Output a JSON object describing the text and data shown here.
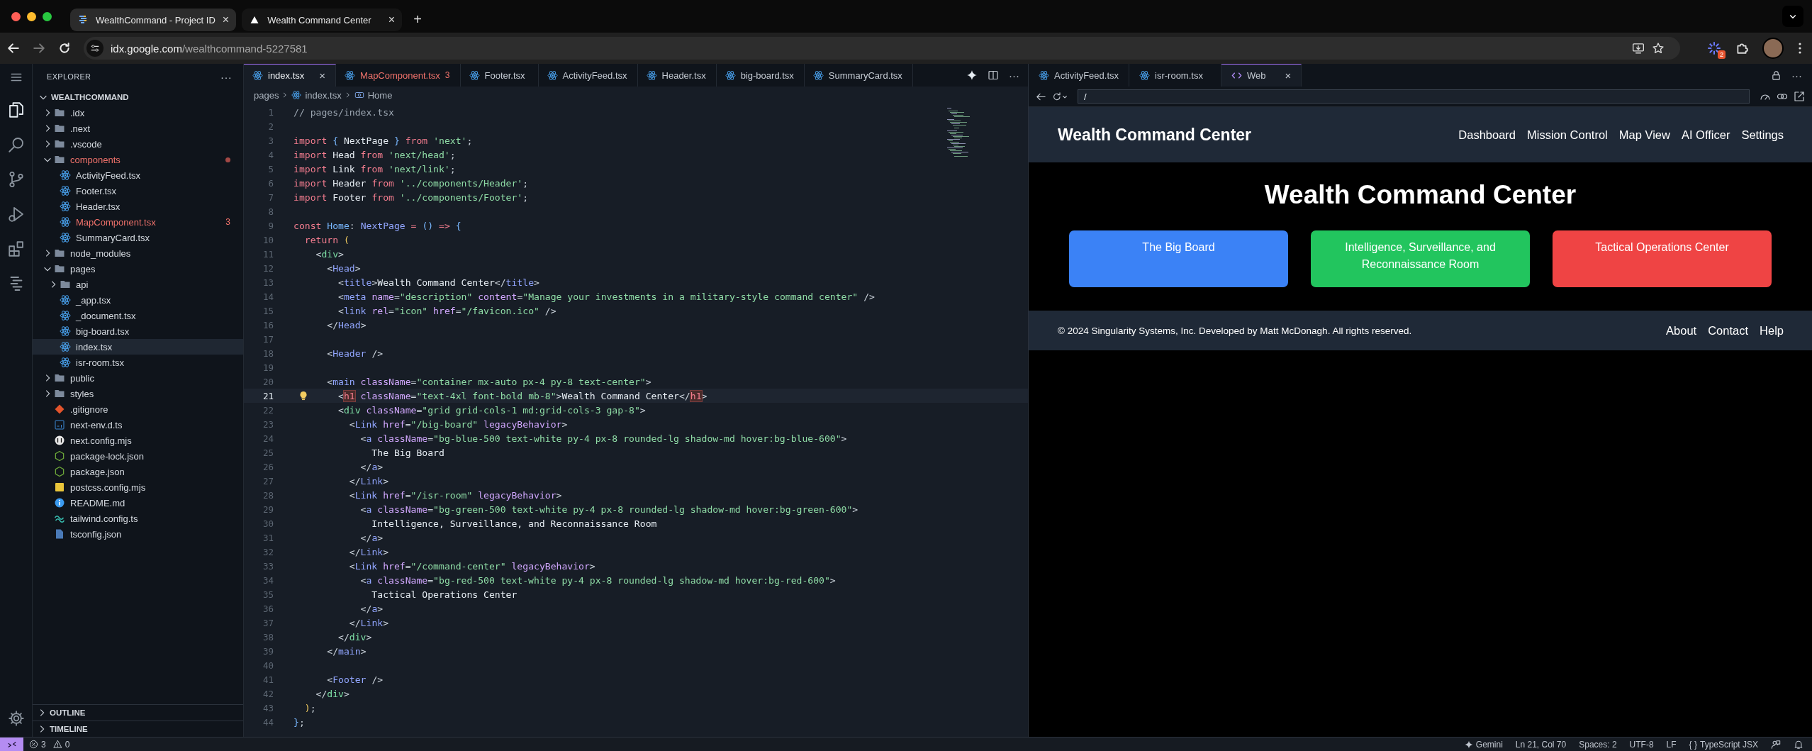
{
  "browser": {
    "tabs": [
      {
        "title": "WealthCommand - Project ID",
        "kind": "idx",
        "selected": true,
        "close": "×"
      },
      {
        "title": "Wealth Command Center",
        "kind": "site",
        "selected": false,
        "close": "×"
      }
    ],
    "new_tab": "+",
    "address": {
      "host": "idx.google.com",
      "path": "/wealthcommand-5227581"
    },
    "extension_badge": "2"
  },
  "activity_bar": [
    {
      "kind": "files",
      "selected": true
    },
    {
      "kind": "search",
      "selected": false
    },
    {
      "kind": "branch",
      "selected": false
    },
    {
      "kind": "run",
      "selected": false
    },
    {
      "kind": "extensions",
      "selected": false
    },
    {
      "kind": "list",
      "selected": false
    }
  ],
  "explorer": {
    "title": "EXPLORER",
    "more": "···",
    "root": "WEALTHCOMMAND",
    "items": [
      {
        "label": ".idx",
        "kind": "folder",
        "expanded": false,
        "selected": false,
        "error": false
      },
      {
        "label": ".next",
        "kind": "folder",
        "expanded": false,
        "selected": false,
        "error": false
      },
      {
        "label": ".vscode",
        "kind": "folder",
        "expanded": false,
        "selected": false,
        "error": false
      },
      {
        "label": "components",
        "kind": "folder",
        "expanded": true,
        "selected": false,
        "error": true,
        "children": [
          {
            "label": "ActivityFeed.tsx",
            "kind": "react",
            "selected": false,
            "error": false
          },
          {
            "label": "Footer.tsx",
            "kind": "react",
            "selected": false,
            "error": false
          },
          {
            "label": "Header.tsx",
            "kind": "react",
            "selected": false,
            "error": false
          },
          {
            "label": "MapComponent.tsx",
            "kind": "react",
            "selected": false,
            "error": true,
            "badge": "3"
          },
          {
            "label": "SummaryCard.tsx",
            "kind": "react",
            "selected": false,
            "error": false
          }
        ]
      },
      {
        "label": "node_modules",
        "kind": "folder",
        "expanded": false,
        "selected": false,
        "error": false
      },
      {
        "label": "pages",
        "kind": "folder",
        "expanded": true,
        "selected": false,
        "error": false,
        "children": [
          {
            "label": "api",
            "kind": "folder",
            "expanded": false,
            "selected": false,
            "error": false
          },
          {
            "label": "_app.tsx",
            "kind": "react",
            "selected": false,
            "error": false
          },
          {
            "label": "_document.tsx",
            "kind": "react",
            "selected": false,
            "error": false
          },
          {
            "label": "big-board.tsx",
            "kind": "react",
            "selected": false,
            "error": false
          },
          {
            "label": "index.tsx",
            "kind": "react",
            "selected": true,
            "error": false
          },
          {
            "label": "isr-room.tsx",
            "kind": "react",
            "selected": false,
            "error": false
          }
        ]
      },
      {
        "label": "public",
        "kind": "folder",
        "expanded": false,
        "selected": false,
        "error": false
      },
      {
        "label": "styles",
        "kind": "folder",
        "expanded": false,
        "selected": false,
        "error": false
      },
      {
        "label": ".gitignore",
        "kind": "git",
        "selected": false,
        "error": false
      },
      {
        "label": "next-env.d.ts",
        "kind": "ts",
        "selected": false,
        "error": false
      },
      {
        "label": "next.config.mjs",
        "kind": "next",
        "selected": false,
        "error": false
      },
      {
        "label": "package-lock.json",
        "kind": "json",
        "selected": false,
        "error": false
      },
      {
        "label": "package.json",
        "kind": "json",
        "selected": false,
        "error": false
      },
      {
        "label": "postcss.config.mjs",
        "kind": "js",
        "selected": false,
        "error": false
      },
      {
        "label": "README.md",
        "kind": "info",
        "selected": false,
        "error": false
      },
      {
        "label": "tailwind.config.ts",
        "kind": "tailwind",
        "selected": false,
        "error": false
      },
      {
        "label": "tsconfig.json",
        "kind": "tsconfig",
        "selected": false,
        "error": false
      }
    ],
    "sections": [
      {
        "label": "OUTLINE",
        "expanded": false
      },
      {
        "label": "TIMELINE",
        "expanded": false
      }
    ]
  },
  "editor": {
    "tabs": [
      {
        "label": "index.tsx",
        "selected": true,
        "error": false,
        "close": "×"
      },
      {
        "label": "MapComponent.tsx",
        "selected": false,
        "error": true,
        "badge": "3"
      },
      {
        "label": "Footer.tsx",
        "selected": false,
        "error": false
      },
      {
        "label": "ActivityFeed.tsx",
        "selected": false,
        "error": false
      },
      {
        "label": "Header.tsx",
        "selected": false,
        "error": false
      },
      {
        "label": "big-board.tsx",
        "selected": false,
        "error": false
      },
      {
        "label": "SummaryCard.tsx",
        "selected": false,
        "error": false
      }
    ],
    "more": "···",
    "breadcrumb": [
      {
        "label": "pages",
        "kind": "folder"
      },
      {
        "label": "index.tsx",
        "kind": "react"
      },
      {
        "label": "Home",
        "kind": "symbol"
      }
    ],
    "lines": [
      {
        "n": "1",
        "current": false,
        "tokens": [
          {
            "kind": "com",
            "text": "// pages/index.tsx"
          }
        ]
      },
      {
        "n": "2",
        "current": false
      },
      {
        "n": "3",
        "current": false,
        "tokens": [
          {
            "kind": "kw",
            "text": "import "
          },
          {
            "kind": "fn",
            "text": "{ "
          },
          {
            "kind": "txt",
            "text": "NextPage "
          },
          {
            "kind": "fn",
            "text": "} "
          },
          {
            "kind": "kw",
            "text": "from "
          },
          {
            "kind": "str",
            "text": "'next'"
          },
          {
            "kind": "p",
            "text": ";"
          }
        ]
      },
      {
        "n": "4",
        "current": false,
        "tokens": [
          {
            "kind": "kw",
            "text": "import "
          },
          {
            "kind": "txt",
            "text": "Head "
          },
          {
            "kind": "kw",
            "text": "from "
          },
          {
            "kind": "str",
            "text": "'next/head'"
          },
          {
            "kind": "p",
            "text": ";"
          }
        ]
      },
      {
        "n": "5",
        "current": false,
        "tokens": [
          {
            "kind": "kw",
            "text": "import "
          },
          {
            "kind": "txt",
            "text": "Link "
          },
          {
            "kind": "kw",
            "text": "from "
          },
          {
            "kind": "str",
            "text": "'next/link'"
          },
          {
            "kind": "p",
            "text": ";"
          }
        ]
      },
      {
        "n": "6",
        "current": false,
        "tokens": [
          {
            "kind": "kw",
            "text": "import "
          },
          {
            "kind": "txt",
            "text": "Header "
          },
          {
            "kind": "kw",
            "text": "from "
          },
          {
            "kind": "str",
            "text": "'../components/Header'"
          },
          {
            "kind": "p",
            "text": ";"
          }
        ]
      },
      {
        "n": "7",
        "current": false,
        "tokens": [
          {
            "kind": "kw",
            "text": "import "
          },
          {
            "kind": "txt",
            "text": "Footer "
          },
          {
            "kind": "kw",
            "text": "from "
          },
          {
            "kind": "str",
            "text": "'../components/Footer'"
          },
          {
            "kind": "p",
            "text": ";"
          }
        ]
      },
      {
        "n": "8",
        "current": false
      },
      {
        "n": "9",
        "current": false,
        "tokens": [
          {
            "kind": "kw",
            "text": "const "
          },
          {
            "kind": "fn",
            "text": "Home"
          },
          {
            "kind": "p",
            "text": ": "
          },
          {
            "kind": "tag",
            "text": "NextPage "
          },
          {
            "kind": "kw",
            "text": "= "
          },
          {
            "kind": "fn",
            "text": "() "
          },
          {
            "kind": "kw",
            "text": "=> "
          },
          {
            "kind": "fn",
            "text": "{"
          }
        ]
      },
      {
        "n": "10",
        "current": false,
        "tokens": [
          {
            "kind": "kw",
            "text": "  return "
          },
          {
            "kind": "paren",
            "text": "("
          }
        ]
      },
      {
        "n": "11",
        "current": false,
        "tokens": [
          {
            "kind": "p",
            "text": "    <"
          },
          {
            "kind": "tagg",
            "text": "div"
          },
          {
            "kind": "p",
            "text": ">"
          }
        ]
      },
      {
        "n": "12",
        "current": false,
        "tokens": [
          {
            "kind": "p",
            "text": "      <"
          },
          {
            "kind": "tag",
            "text": "Head"
          },
          {
            "kind": "p",
            "text": ">"
          }
        ]
      },
      {
        "n": "13",
        "current": false,
        "tokens": [
          {
            "kind": "p",
            "text": "        <"
          },
          {
            "kind": "tag",
            "text": "title"
          },
          {
            "kind": "p",
            "text": ">"
          },
          {
            "kind": "txt",
            "text": "Wealth Command Center"
          },
          {
            "kind": "p",
            "text": "</"
          },
          {
            "kind": "tag",
            "text": "title"
          },
          {
            "kind": "p",
            "text": ">"
          }
        ]
      },
      {
        "n": "14",
        "current": false,
        "tokens": [
          {
            "kind": "p",
            "text": "        <"
          },
          {
            "kind": "tag",
            "text": "meta "
          },
          {
            "kind": "attr",
            "text": "name"
          },
          {
            "kind": "p",
            "text": "="
          },
          {
            "kind": "str",
            "text": "\"description\" "
          },
          {
            "kind": "attr",
            "text": "content"
          },
          {
            "kind": "p",
            "text": "="
          },
          {
            "kind": "str",
            "text": "\"Manage your investments in a military-style command center\" "
          },
          {
            "kind": "p",
            "text": "/>"
          }
        ]
      },
      {
        "n": "15",
        "current": false,
        "tokens": [
          {
            "kind": "p",
            "text": "        <"
          },
          {
            "kind": "tag",
            "text": "link "
          },
          {
            "kind": "attr",
            "text": "rel"
          },
          {
            "kind": "p",
            "text": "="
          },
          {
            "kind": "str",
            "text": "\"icon\" "
          },
          {
            "kind": "attr",
            "text": "href"
          },
          {
            "kind": "p",
            "text": "="
          },
          {
            "kind": "str",
            "text": "\"/favicon.ico\" "
          },
          {
            "kind": "p",
            "text": "/>"
          }
        ]
      },
      {
        "n": "16",
        "current": false,
        "tokens": [
          {
            "kind": "p",
            "text": "      </"
          },
          {
            "kind": "tag",
            "text": "Head"
          },
          {
            "kind": "p",
            "text": ">"
          }
        ]
      },
      {
        "n": "17",
        "current": false
      },
      {
        "n": "18",
        "current": false,
        "tokens": [
          {
            "kind": "p",
            "text": "      <"
          },
          {
            "kind": "tag",
            "text": "Header "
          },
          {
            "kind": "p",
            "text": "/>"
          }
        ]
      },
      {
        "n": "19",
        "current": false
      },
      {
        "n": "20",
        "current": false,
        "tokens": [
          {
            "kind": "p",
            "text": "      <"
          },
          {
            "kind": "tag",
            "text": "main "
          },
          {
            "kind": "attr",
            "text": "className"
          },
          {
            "kind": "p",
            "text": "="
          },
          {
            "kind": "str",
            "text": "\"container mx-auto px-4 py-8 text-center\""
          },
          {
            "kind": "p",
            "text": ">"
          }
        ]
      },
      {
        "n": "21",
        "current": true,
        "tokens": [
          {
            "kind": "p",
            "text": "        <"
          },
          {
            "kind": "match",
            "text": "h1"
          },
          {
            "kind": "attr",
            "text": " className"
          },
          {
            "kind": "p",
            "text": "="
          },
          {
            "kind": "str",
            "text": "\"text-4xl font-bold mb-8\""
          },
          {
            "kind": "p",
            "text": ">"
          },
          {
            "kind": "txt",
            "text": "Wealth Command Center"
          },
          {
            "kind": "p",
            "text": "</"
          },
          {
            "kind": "match",
            "text": "h1"
          },
          {
            "kind": "p",
            "text": ">"
          }
        ]
      },
      {
        "n": "22",
        "current": false,
        "tokens": [
          {
            "kind": "p",
            "text": "        <"
          },
          {
            "kind": "tagg",
            "text": "div "
          },
          {
            "kind": "attr",
            "text": "className"
          },
          {
            "kind": "p",
            "text": "="
          },
          {
            "kind": "str",
            "text": "\"grid grid-cols-1 md:grid-cols-3 gap-8\""
          },
          {
            "kind": "p",
            "text": ">"
          }
        ]
      },
      {
        "n": "23",
        "current": false,
        "tokens": [
          {
            "kind": "p",
            "text": "          <"
          },
          {
            "kind": "tag",
            "text": "Link "
          },
          {
            "kind": "attr",
            "text": "href"
          },
          {
            "kind": "p",
            "text": "="
          },
          {
            "kind": "str",
            "text": "\"/big-board\" "
          },
          {
            "kind": "attr",
            "text": "legacyBehavior"
          },
          {
            "kind": "p",
            "text": ">"
          }
        ]
      },
      {
        "n": "24",
        "current": false,
        "tokens": [
          {
            "kind": "p",
            "text": "            <"
          },
          {
            "kind": "tag",
            "text": "a "
          },
          {
            "kind": "attr",
            "text": "className"
          },
          {
            "kind": "p",
            "text": "="
          },
          {
            "kind": "str",
            "text": "\"bg-blue-500 text-white py-4 px-8 rounded-lg shadow-md hover:bg-blue-600\""
          },
          {
            "kind": "p",
            "text": ">"
          }
        ]
      },
      {
        "n": "25",
        "current": false,
        "tokens": [
          {
            "kind": "txt",
            "text": "              The Big Board"
          }
        ]
      },
      {
        "n": "26",
        "current": false,
        "tokens": [
          {
            "kind": "p",
            "text": "            </"
          },
          {
            "kind": "tag",
            "text": "a"
          },
          {
            "kind": "p",
            "text": ">"
          }
        ]
      },
      {
        "n": "27",
        "current": false,
        "tokens": [
          {
            "kind": "p",
            "text": "          </"
          },
          {
            "kind": "tag",
            "text": "Link"
          },
          {
            "kind": "p",
            "text": ">"
          }
        ]
      },
      {
        "n": "28",
        "current": false,
        "tokens": [
          {
            "kind": "p",
            "text": "          <"
          },
          {
            "kind": "tag",
            "text": "Link "
          },
          {
            "kind": "attr",
            "text": "href"
          },
          {
            "kind": "p",
            "text": "="
          },
          {
            "kind": "str",
            "text": "\"/isr-room\" "
          },
          {
            "kind": "attr",
            "text": "legacyBehavior"
          },
          {
            "kind": "p",
            "text": ">"
          }
        ]
      },
      {
        "n": "29",
        "current": false,
        "tokens": [
          {
            "kind": "p",
            "text": "            <"
          },
          {
            "kind": "tag",
            "text": "a "
          },
          {
            "kind": "attr",
            "text": "className"
          },
          {
            "kind": "p",
            "text": "="
          },
          {
            "kind": "str",
            "text": "\"bg-green-500 text-white py-4 px-8 rounded-lg shadow-md hover:bg-green-600\""
          },
          {
            "kind": "p",
            "text": ">"
          }
        ]
      },
      {
        "n": "30",
        "current": false,
        "tokens": [
          {
            "kind": "txt",
            "text": "              Intelligence, Surveillance, and Reconnaissance Room"
          }
        ]
      },
      {
        "n": "31",
        "current": false,
        "tokens": [
          {
            "kind": "p",
            "text": "            </"
          },
          {
            "kind": "tag",
            "text": "a"
          },
          {
            "kind": "p",
            "text": ">"
          }
        ]
      },
      {
        "n": "32",
        "current": false,
        "tokens": [
          {
            "kind": "p",
            "text": "          </"
          },
          {
            "kind": "tag",
            "text": "Link"
          },
          {
            "kind": "p",
            "text": ">"
          }
        ]
      },
      {
        "n": "33",
        "current": false,
        "tokens": [
          {
            "kind": "p",
            "text": "          <"
          },
          {
            "kind": "tag",
            "text": "Link "
          },
          {
            "kind": "attr",
            "text": "href"
          },
          {
            "kind": "p",
            "text": "="
          },
          {
            "kind": "str",
            "text": "\"/command-center\" "
          },
          {
            "kind": "attr",
            "text": "legacyBehavior"
          },
          {
            "kind": "p",
            "text": ">"
          }
        ]
      },
      {
        "n": "34",
        "current": false,
        "tokens": [
          {
            "kind": "p",
            "text": "            <"
          },
          {
            "kind": "tag",
            "text": "a "
          },
          {
            "kind": "attr",
            "text": "className"
          },
          {
            "kind": "p",
            "text": "="
          },
          {
            "kind": "str",
            "text": "\"bg-red-500 text-white py-4 px-8 rounded-lg shadow-md hover:bg-red-600\""
          },
          {
            "kind": "p",
            "text": ">"
          }
        ]
      },
      {
        "n": "35",
        "current": false,
        "tokens": [
          {
            "kind": "txt",
            "text": "              Tactical Operations Center"
          }
        ]
      },
      {
        "n": "36",
        "current": false,
        "tokens": [
          {
            "kind": "p",
            "text": "            </"
          },
          {
            "kind": "tag",
            "text": "a"
          },
          {
            "kind": "p",
            "text": ">"
          }
        ]
      },
      {
        "n": "37",
        "current": false,
        "tokens": [
          {
            "kind": "p",
            "text": "          </"
          },
          {
            "kind": "tag",
            "text": "Link"
          },
          {
            "kind": "p",
            "text": ">"
          }
        ]
      },
      {
        "n": "38",
        "current": false,
        "tokens": [
          {
            "kind": "p",
            "text": "        </"
          },
          {
            "kind": "tagg",
            "text": "div"
          },
          {
            "kind": "p",
            "text": ">"
          }
        ]
      },
      {
        "n": "39",
        "current": false,
        "tokens": [
          {
            "kind": "p",
            "text": "      </"
          },
          {
            "kind": "tag",
            "text": "main"
          },
          {
            "kind": "p",
            "text": ">"
          }
        ]
      },
      {
        "n": "40",
        "current": false
      },
      {
        "n": "41",
        "current": false,
        "tokens": [
          {
            "kind": "p",
            "text": "      <"
          },
          {
            "kind": "tag",
            "text": "Footer "
          },
          {
            "kind": "p",
            "text": "/>"
          }
        ]
      },
      {
        "n": "42",
        "current": false,
        "tokens": [
          {
            "kind": "p",
            "text": "    </"
          },
          {
            "kind": "tagg",
            "text": "div"
          },
          {
            "kind": "p",
            "text": ">"
          }
        ]
      },
      {
        "n": "43",
        "current": false,
        "tokens": [
          {
            "kind": "paren",
            "text": "  )"
          },
          {
            "kind": "p",
            "text": ";"
          }
        ]
      },
      {
        "n": "44",
        "current": false,
        "tokens": [
          {
            "kind": "fn",
            "text": "}"
          },
          {
            "kind": "p",
            "text": ";"
          }
        ]
      }
    ]
  },
  "preview": {
    "tabs": [
      {
        "label": "ActivityFeed.tsx",
        "kind": "react",
        "selected": false
      },
      {
        "label": "isr-room.tsx",
        "kind": "react",
        "selected": false
      },
      {
        "label": "Web",
        "kind": "web",
        "selected": true,
        "close": "×"
      }
    ],
    "more": "···",
    "url": "/",
    "site": {
      "brand": "Wealth Command Center",
      "nav": [
        "Dashboard",
        "Mission Control",
        "Map View",
        "AI Officer",
        "Settings"
      ],
      "heading": "Wealth Command Center",
      "cards": [
        {
          "label": "The Big Board",
          "color": "#3b82f6"
        },
        {
          "label": "Intelligence, Surveillance, and Reconnaissance Room",
          "color": "#22c55e"
        },
        {
          "label": "Tactical Operations Center",
          "color": "#ef4444"
        }
      ],
      "footer_text": "© 2024 Singularity Systems, Inc. Developed by Matt McDonagh. All rights reserved.",
      "footer_links": [
        "About",
        "Contact",
        "Help"
      ]
    }
  },
  "status_bar": {
    "errors": "3",
    "warnings": "0",
    "items": [
      {
        "kind": "gemini",
        "label": "Gemini"
      },
      {
        "kind": "text",
        "label": "Ln 21, Col 70"
      },
      {
        "kind": "text",
        "label": "Spaces: 2"
      },
      {
        "kind": "text",
        "label": "UTF-8"
      },
      {
        "kind": "text",
        "label": "LF"
      },
      {
        "kind": "lang",
        "icon": "{ }",
        "label": "TypeScript JSX"
      }
    ]
  }
}
